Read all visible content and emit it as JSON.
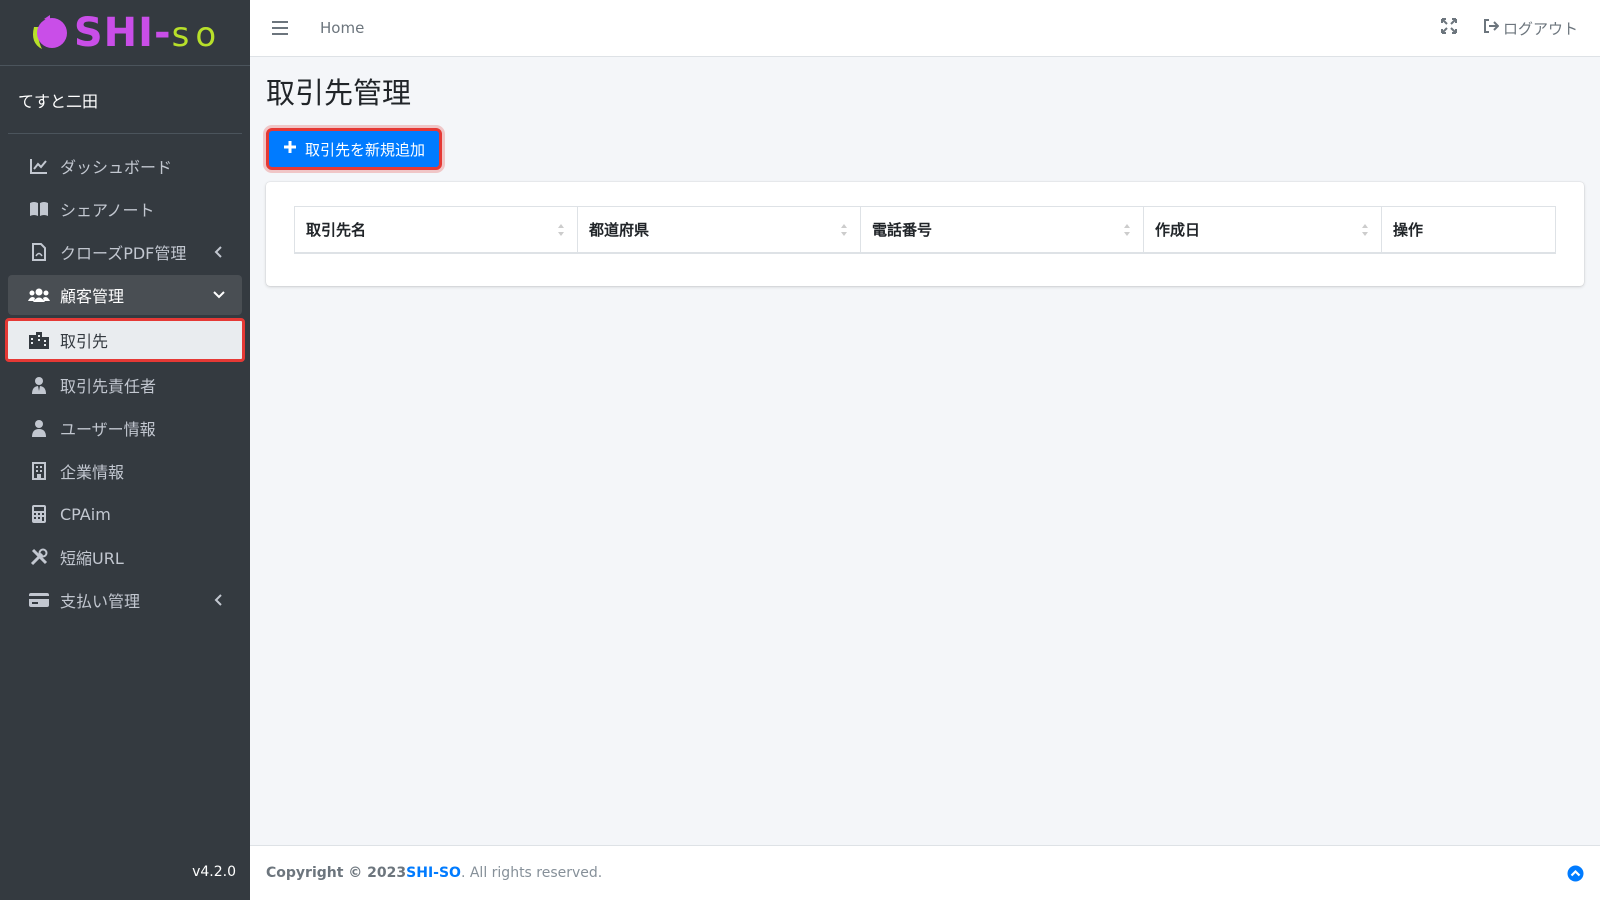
{
  "brand": {
    "part1": "SHI",
    "sep": "-",
    "part2": "so",
    "colors": {
      "purple": "#c94ee8",
      "green": "#b8e02a"
    }
  },
  "user": {
    "name": "てすと二田"
  },
  "sidebar": {
    "items": [
      {
        "label": "ダッシュボード",
        "icon": "chart-line-icon"
      },
      {
        "label": "シェアノート",
        "icon": "book-open-icon"
      },
      {
        "label": "クローズPDF管理",
        "icon": "file-pdf-icon",
        "chevron": "left"
      },
      {
        "label": "顧客管理",
        "icon": "users-icon",
        "chevron": "down",
        "state": "open"
      },
      {
        "label": "取引先",
        "icon": "city-icon",
        "state": "active"
      },
      {
        "label": "取引先責任者",
        "icon": "user-tie-icon"
      },
      {
        "label": "ユーザー情報",
        "icon": "user-icon"
      },
      {
        "label": "企業情報",
        "icon": "building-icon"
      },
      {
        "label": "CPAim",
        "icon": "calculator-icon"
      },
      {
        "label": "短縮URL",
        "icon": "tools-icon"
      },
      {
        "label": "支払い管理",
        "icon": "credit-card-icon",
        "chevron": "left"
      }
    ],
    "version": "v4.2.0"
  },
  "topbar": {
    "home": "Home",
    "logout": "ログアウト"
  },
  "main": {
    "title": "取引先管理",
    "add_button": "取引先を新規追加",
    "table": {
      "columns": [
        "取引先名",
        "都道府県",
        "電話番号",
        "作成日",
        "操作"
      ],
      "rows": []
    }
  },
  "footer": {
    "copyright": "Copyright © 2023 ",
    "brand": "SHI-SO",
    "rest": ". All rights reserved."
  },
  "colors": {
    "sidebar_bg": "#343a40",
    "primary": "#007bff",
    "highlight": "#e53935"
  }
}
